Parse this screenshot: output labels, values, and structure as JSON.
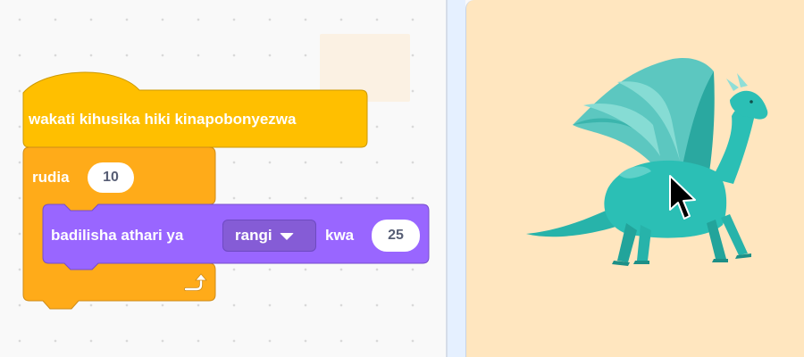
{
  "workspace": {
    "hat_block": {
      "label": "wakati kihusika hiki kinapobonyezwa"
    },
    "repeat_block": {
      "label": "rudia",
      "count": "10"
    },
    "effect_block": {
      "label": "badilisha athari ya",
      "effect_option": "rangi",
      "by_label": "kwa",
      "amount": "25"
    }
  },
  "colors": {
    "events_block": "#ffbf00",
    "control_block": "#ffab19",
    "looks_block": "#9966ff",
    "stage_background": "#ffe6bf",
    "dragon": "#2bbfb5"
  },
  "stage": {
    "sprite_icon": "dragon-sprite",
    "cursor_icon": "arrow-cursor-icon"
  }
}
